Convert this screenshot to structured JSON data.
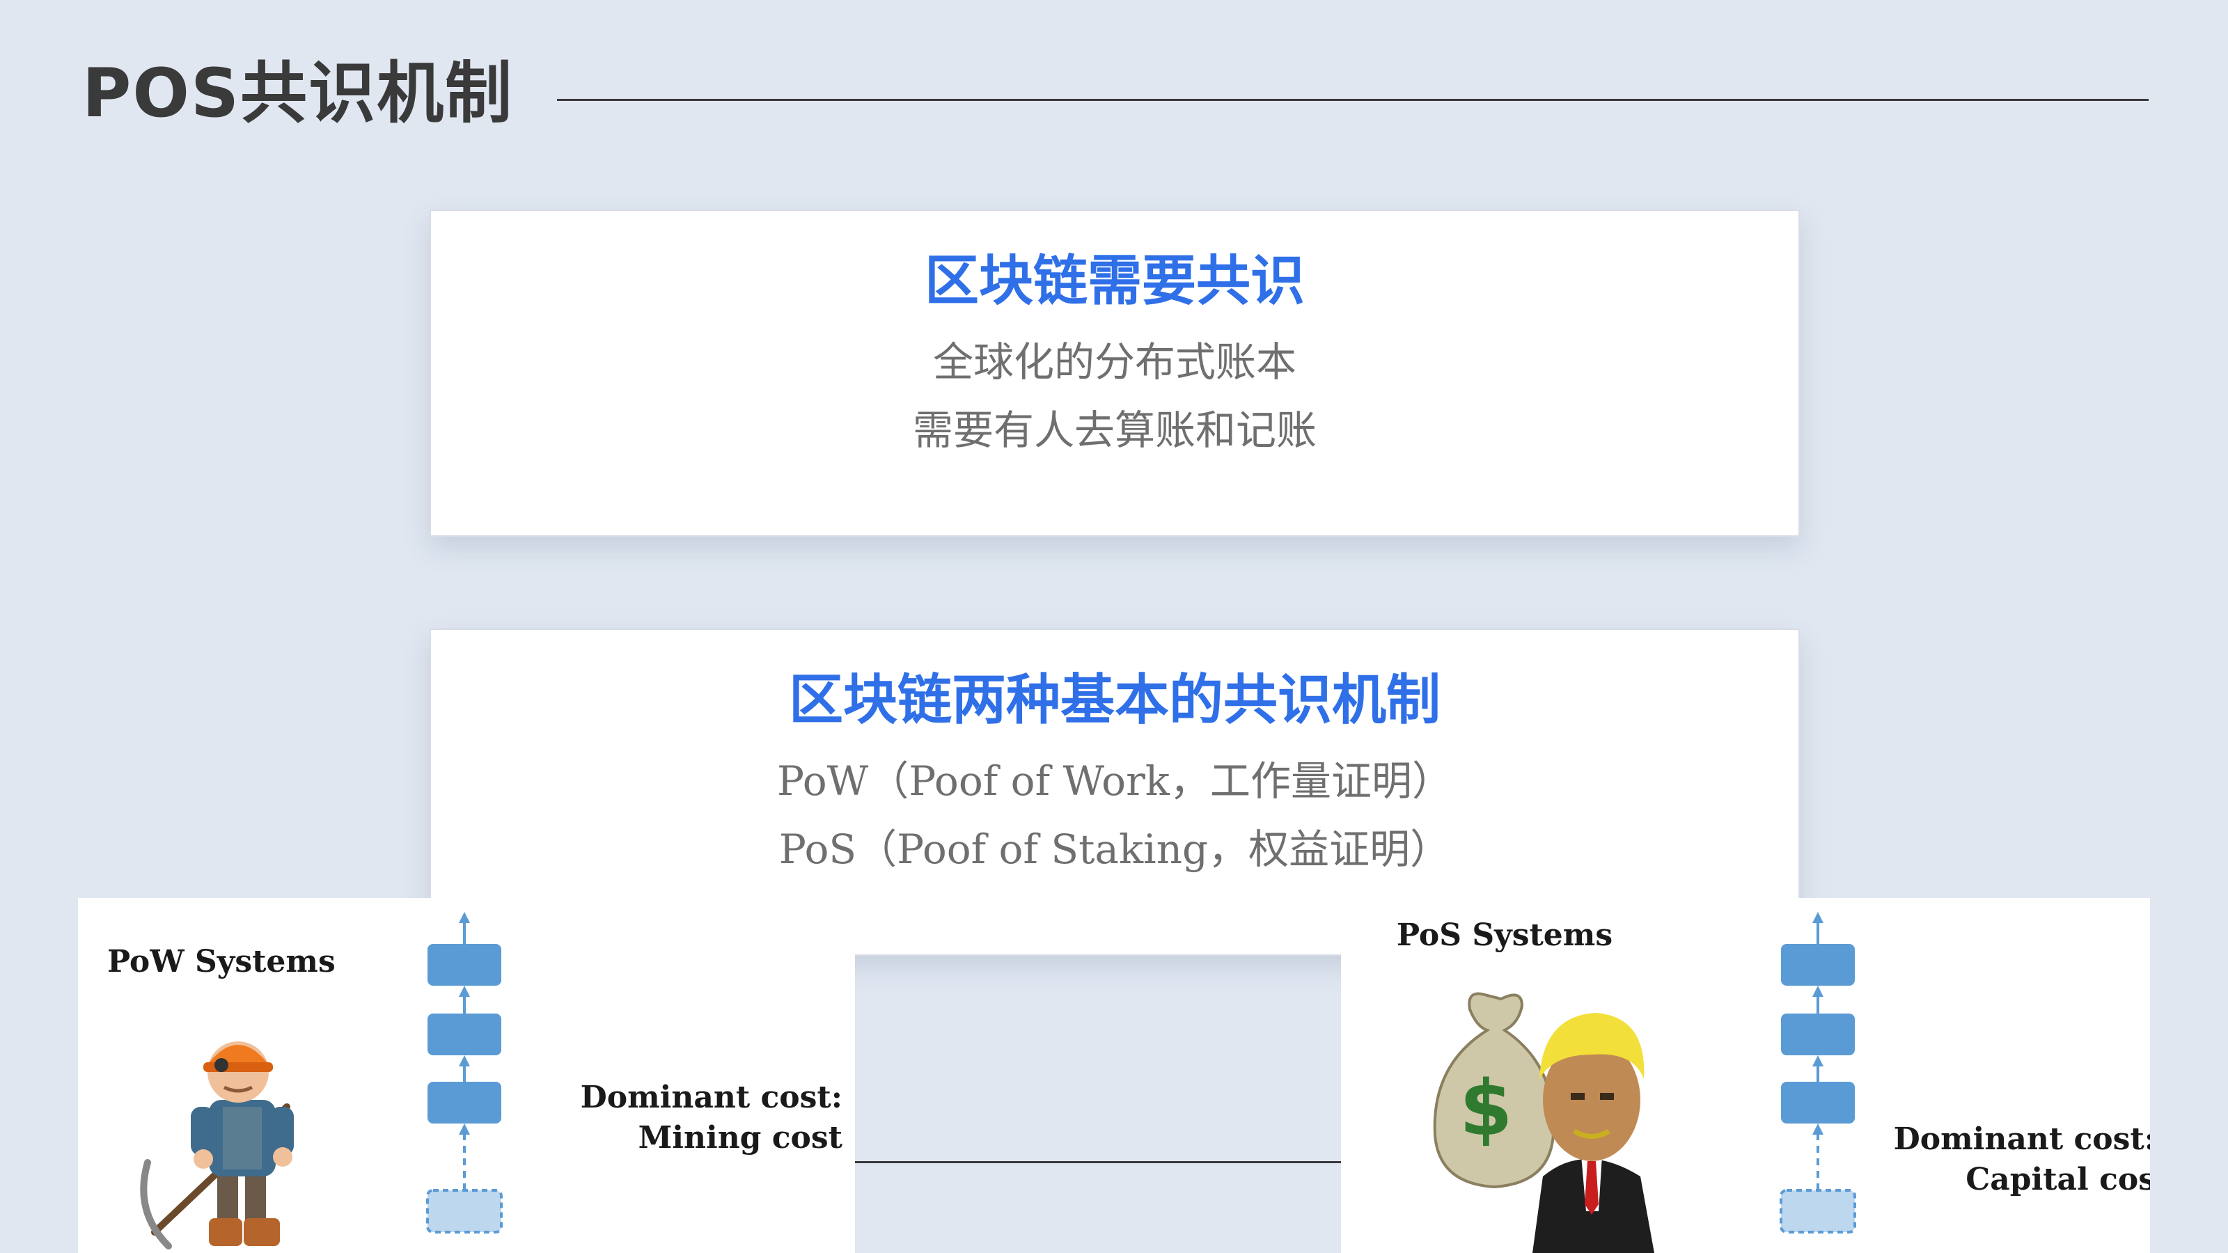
{
  "page": {
    "title": "POS共识机制"
  },
  "card1": {
    "heading": "区块链需要共识",
    "lines": [
      "全球化的分布式账本",
      "需要有人去算账和记账"
    ]
  },
  "card2": {
    "heading": "区块链两种基本的共识机制",
    "lines": [
      "PoW（Poof of Work，工作量证明）",
      "PoS（Poof of Staking，权益证明）"
    ]
  },
  "pow_panel": {
    "label": "PoW Systems",
    "cost_title": "Dominant cost:",
    "cost_value": "Mining cost",
    "figure_icon": "miner-with-pickaxe",
    "chain_icon": "blockchain-chain"
  },
  "pos_panel": {
    "label": "PoS Systems",
    "cost_title": "Dominant cost:",
    "cost_value": "Capital cos",
    "figure_icon": "businessman-with-money-bag",
    "money_symbol": "$",
    "chain_icon": "blockchain-chain"
  },
  "colors": {
    "background": "#e0e7f1",
    "accent": "#2f6fe8",
    "title": "#3a3a3a",
    "body_text": "#6f6f6f",
    "block": "#5b9bd5",
    "pending_block": "#bdd7ee"
  }
}
